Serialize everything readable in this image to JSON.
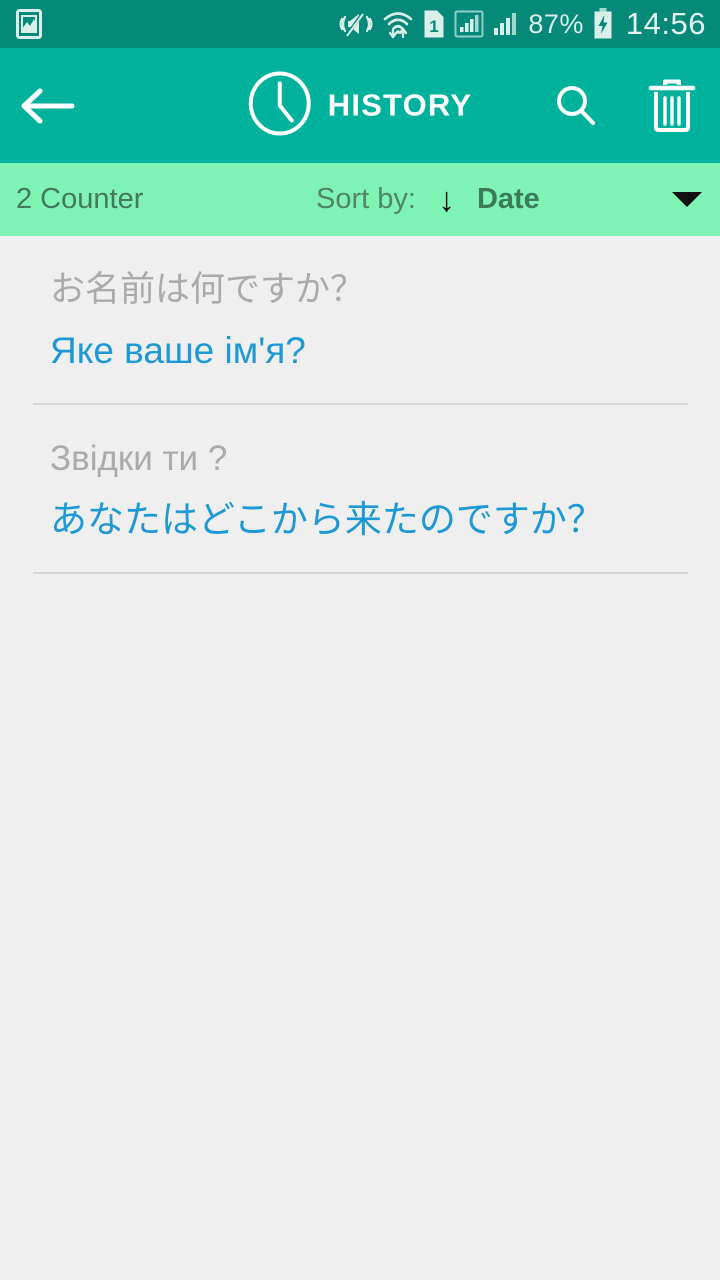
{
  "status_bar": {
    "time": "14:56",
    "battery_percent": "87%",
    "icons": [
      {
        "name": "image-notification-icon"
      },
      {
        "name": "vibrate-mute-icon"
      },
      {
        "name": "wifi-transfer-icon"
      },
      {
        "name": "sim-1-icon",
        "label": "1"
      },
      {
        "name": "signal-boxed-icon"
      },
      {
        "name": "signal-bars-icon"
      },
      {
        "name": "battery-charging-icon"
      }
    ],
    "background_color": "#07897a",
    "text_color": "#d9ece7"
  },
  "action_bar": {
    "title": "HISTORY",
    "back_label": "Back",
    "clock_icon": "clock-icon",
    "search_label": "Search",
    "delete_label": "Delete all",
    "background_color": "#00b29c"
  },
  "sort_bar": {
    "counter": "2 Counter",
    "sort_label": "Sort by:",
    "sort_direction_arrow": "↓",
    "sort_value": "Date",
    "background_color": "#7ff3b6",
    "dropdown_options": [
      "Date"
    ]
  },
  "list": {
    "items": [
      {
        "source": "お名前は何ですか？",
        "target": "Яке ваше ім'я?"
      },
      {
        "source": "Звідки ти ?",
        "target": "あなたはどこから来たのですか？"
      }
    ],
    "source_color": "#aaaaaa",
    "target_color": "#1e99d4",
    "background_color": "#efefef"
  }
}
